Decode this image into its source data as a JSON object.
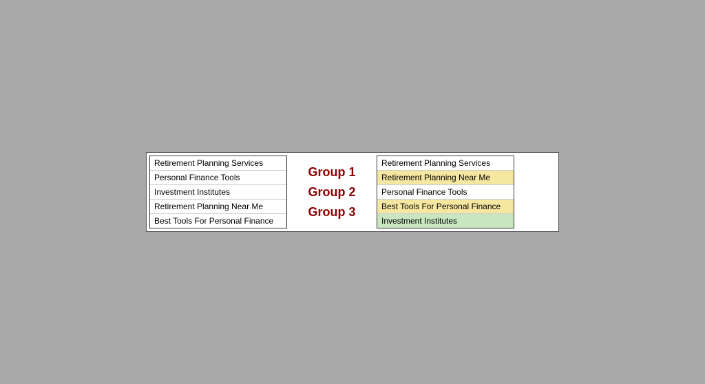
{
  "left_panel": {
    "items": [
      {
        "label": "Retirement Planning Services"
      },
      {
        "label": "Personal Finance Tools"
      },
      {
        "label": "Investment Institutes"
      },
      {
        "label": "Retirement Planning Near Me"
      },
      {
        "label": "Best Tools For Personal Finance"
      }
    ]
  },
  "middle_panel": {
    "groups": [
      {
        "label": "Group 1"
      },
      {
        "label": "Group 2"
      },
      {
        "label": "Group 3"
      }
    ]
  },
  "right_panel": {
    "items": [
      {
        "label": "Retirement Planning Services",
        "highlight": "none"
      },
      {
        "label": "Retirement Planning Near Me",
        "highlight": "yellow"
      },
      {
        "label": "Personal Finance Tools",
        "highlight": "none"
      },
      {
        "label": "Best Tools For Personal Finance",
        "highlight": "yellow"
      },
      {
        "label": "Investment Institutes",
        "highlight": "green"
      }
    ]
  }
}
